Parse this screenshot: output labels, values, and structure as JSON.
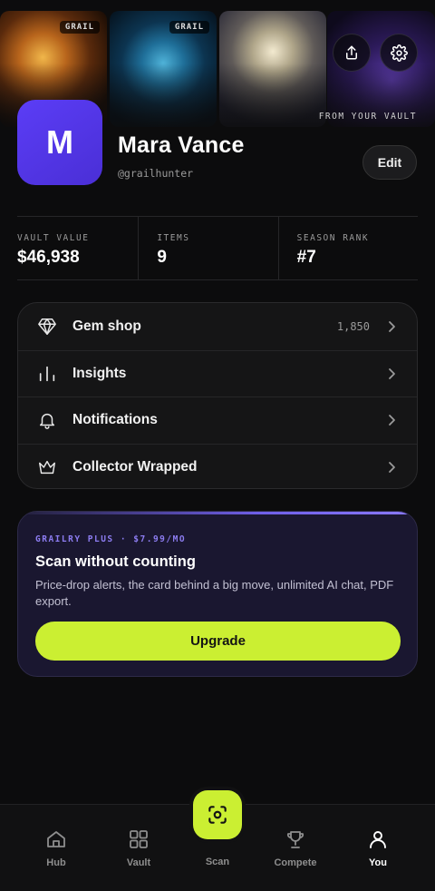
{
  "banner": {
    "tiles": [
      {
        "badge": "GRAIL"
      },
      {
        "badge": "GRAIL"
      },
      {
        "badge": ""
      },
      {
        "badge": ""
      }
    ],
    "caption": "FROM YOUR VAULT"
  },
  "header_actions": {
    "share_icon": "share-icon",
    "settings_icon": "gear-icon"
  },
  "profile": {
    "avatar_initial": "M",
    "avatar_color": "#5b3df6",
    "name": "Mara Vance",
    "handle": "@grailhunter",
    "edit_label": "Edit"
  },
  "stats": [
    {
      "label": "VAULT VALUE",
      "value": "$46,938"
    },
    {
      "label": "ITEMS",
      "value": "9"
    },
    {
      "label": "SEASON RANK",
      "value": "#7"
    }
  ],
  "menu": [
    {
      "label": "Gem shop",
      "value": "1,850",
      "icon": "gem-icon"
    },
    {
      "label": "Insights",
      "value": "",
      "icon": "bar-chart-icon"
    },
    {
      "label": "Notifications",
      "value": "",
      "icon": "bell-icon"
    },
    {
      "label": "Collector Wrapped",
      "value": "",
      "icon": "crown-icon"
    }
  ],
  "plus": {
    "eyebrow": "GRAILRY PLUS · $7.99/MO",
    "title": "Scan without counting",
    "description": "Price-drop alerts, the card behind a big move, unlimited AI chat, PDF export.",
    "cta": "Upgrade",
    "accent_color": "#cbef32"
  },
  "nav": {
    "items": [
      {
        "label": "Hub",
        "icon": "home-icon",
        "active": false
      },
      {
        "label": "Vault",
        "icon": "grid-icon",
        "active": false
      },
      {
        "label": "Scan",
        "icon": "scan-icon",
        "active": false
      },
      {
        "label": "Compete",
        "icon": "trophy-icon",
        "active": false
      },
      {
        "label": "You",
        "icon": "user-icon",
        "active": true
      }
    ]
  }
}
